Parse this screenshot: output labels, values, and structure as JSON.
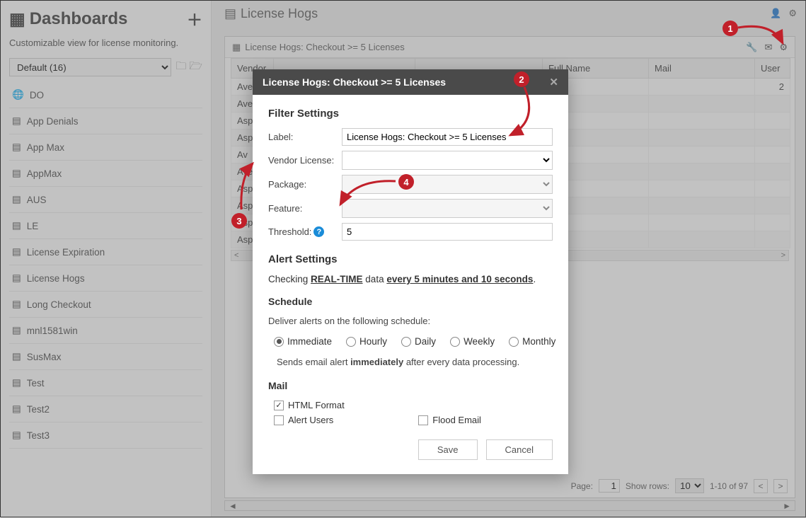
{
  "sidebar": {
    "title": "Dashboards",
    "subtitle": "Customizable view for license monitoring.",
    "select_value": "Default (16)",
    "items": [
      {
        "label": "DO",
        "icon": "globe"
      },
      {
        "label": "App Denials",
        "icon": "report"
      },
      {
        "label": "App Max",
        "icon": "report"
      },
      {
        "label": "AppMax",
        "icon": "report"
      },
      {
        "label": "AUS",
        "icon": "report"
      },
      {
        "label": "LE",
        "icon": "report"
      },
      {
        "label": "License Expiration",
        "icon": "report"
      },
      {
        "label": "License Hogs",
        "icon": "report"
      },
      {
        "label": "Long Checkout",
        "icon": "report"
      },
      {
        "label": "mnl1581win",
        "icon": "report"
      },
      {
        "label": "SusMax",
        "icon": "report"
      },
      {
        "label": "Test",
        "icon": "report"
      },
      {
        "label": "Test2",
        "icon": "report"
      },
      {
        "label": "Test3",
        "icon": "report"
      }
    ]
  },
  "main": {
    "title": "License Hogs"
  },
  "widget": {
    "title": "License Hogs: Checkout >= 5 Licenses",
    "columns": [
      "Vendor",
      "",
      "",
      "Full Name",
      "Mail",
      "User"
    ],
    "rows": [
      "Avev",
      "Avev",
      "Aspe",
      "Aspe",
      "Av",
      "Avev",
      "Aspe",
      "Aspe",
      "Aspe",
      "Aspe"
    ],
    "footer": {
      "page_label": "Page:",
      "page_value": "1",
      "showrows_label": "Show rows:",
      "showrows_value": "10",
      "range": "1-10 of 97"
    }
  },
  "modal": {
    "title": "License Hogs: Checkout >= 5 Licenses",
    "filter_heading": "Filter Settings",
    "label_field": "Label:",
    "label_value": "License Hogs: Checkout >= 5 Licenses",
    "vendor_field": "Vendor License:",
    "package_field": "Package:",
    "feature_field": "Feature:",
    "threshold_field": "Threshold:",
    "threshold_value": "5",
    "alert_heading": "Alert Settings",
    "alert_prefix": "Checking ",
    "alert_mode": "REAL-TIME",
    "alert_mid": " data ",
    "alert_interval": "every 5 minutes and 10 seconds",
    "schedule_heading": "Schedule",
    "schedule_sub": "Deliver alerts on the following schedule:",
    "radios": [
      "Immediate",
      "Hourly",
      "Daily",
      "Weekly",
      "Monthly"
    ],
    "schedule_note_a": "Sends email alert ",
    "schedule_note_b": "immediately",
    "schedule_note_c": " after every data processing.",
    "mail_heading": "Mail",
    "chk_html": "HTML Format",
    "chk_alert": "Alert Users",
    "chk_flood": "Flood Email",
    "save": "Save",
    "cancel": "Cancel"
  },
  "badges": {
    "b1": "1",
    "b2": "2",
    "b3": "3",
    "b4": "4"
  }
}
